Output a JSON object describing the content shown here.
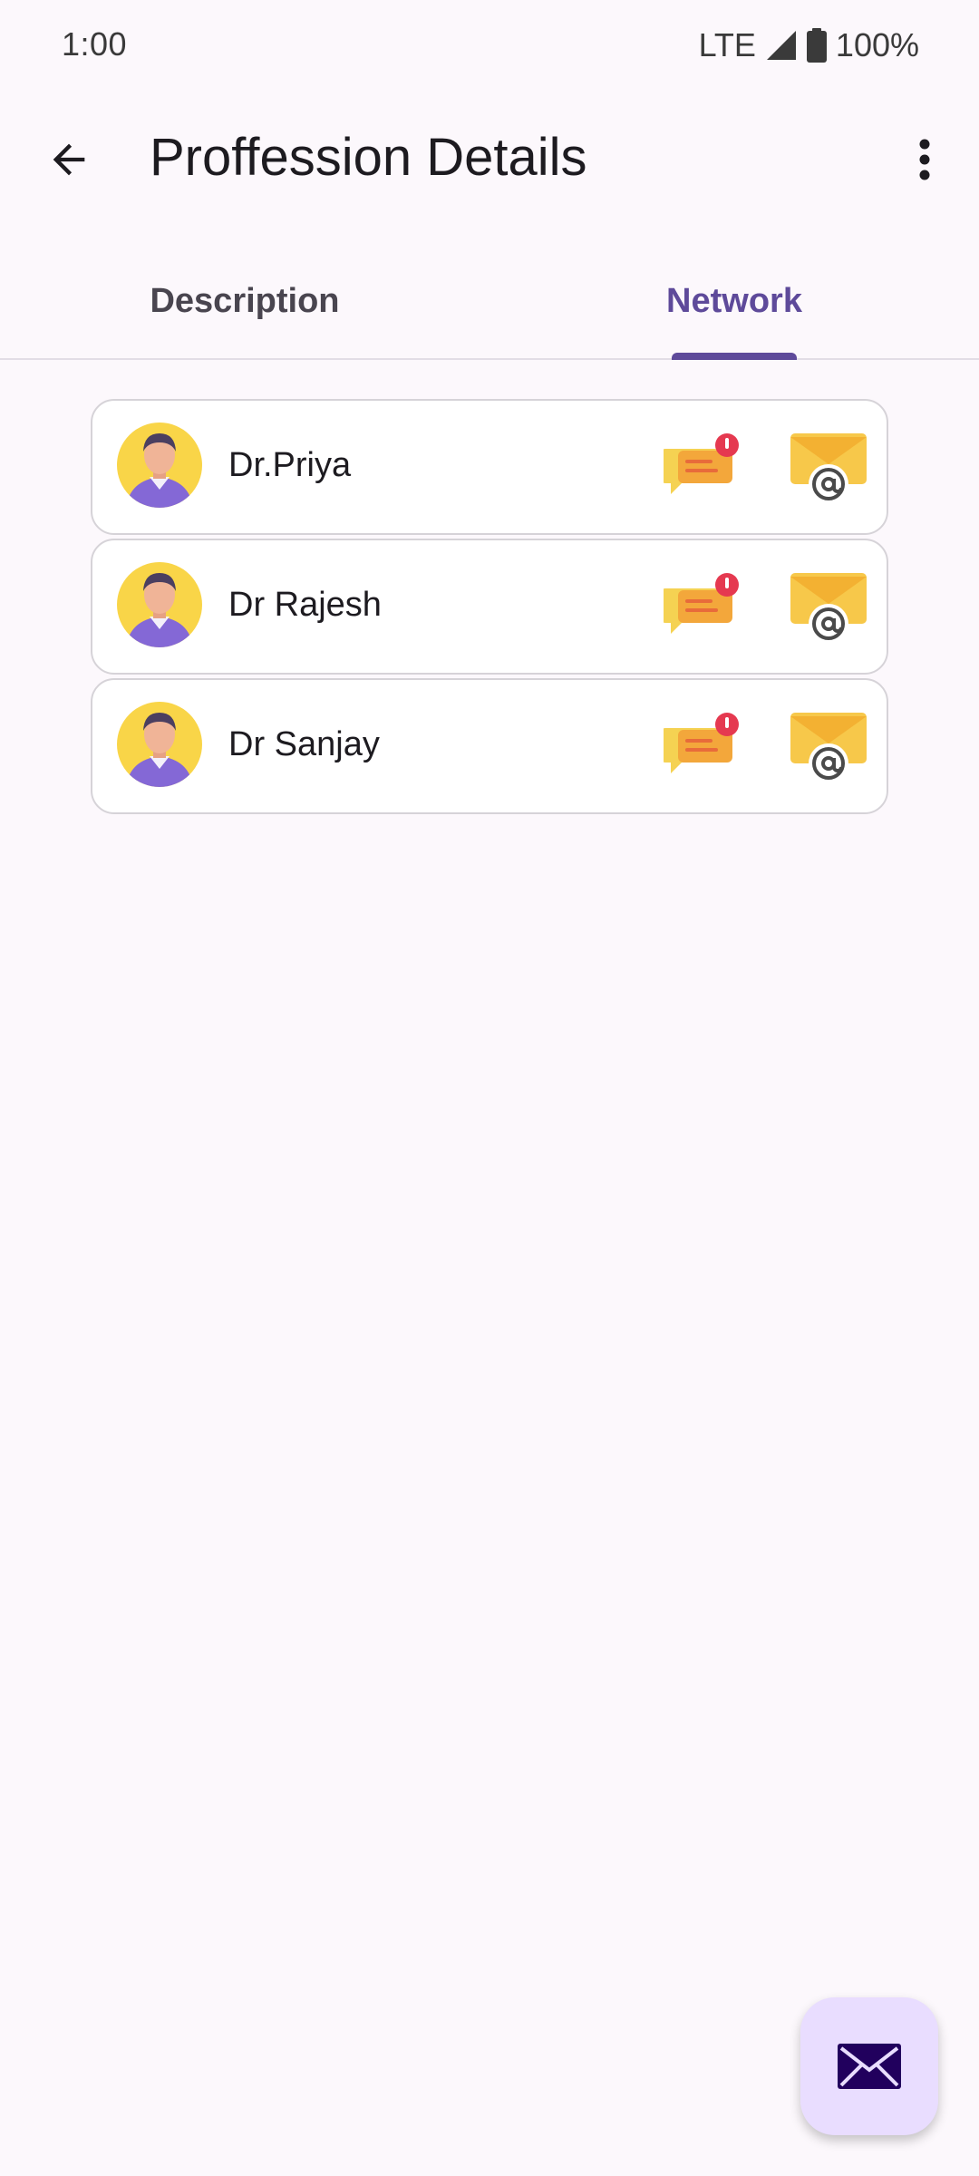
{
  "status_bar": {
    "time": "1:00",
    "network": "LTE",
    "battery": "100%"
  },
  "app_bar": {
    "title": "Proffession Details"
  },
  "tabs": [
    {
      "label": "Description",
      "selected": false
    },
    {
      "label": "Network",
      "selected": true
    }
  ],
  "contacts": [
    {
      "name": "Dr.Priya"
    },
    {
      "name": "Dr Rajesh"
    },
    {
      "name": "Dr Sanjay"
    }
  ],
  "colors": {
    "accent": "#5e4a9a",
    "fab_bg": "#e9ddff",
    "avatar_bg": "#f9d548",
    "badge_red": "#e53950"
  },
  "icons": {
    "back": "arrow-back-icon",
    "more": "more-vert-icon",
    "chat": "chat-alert-icon",
    "mail": "email-at-icon",
    "fab": "mail-icon"
  }
}
